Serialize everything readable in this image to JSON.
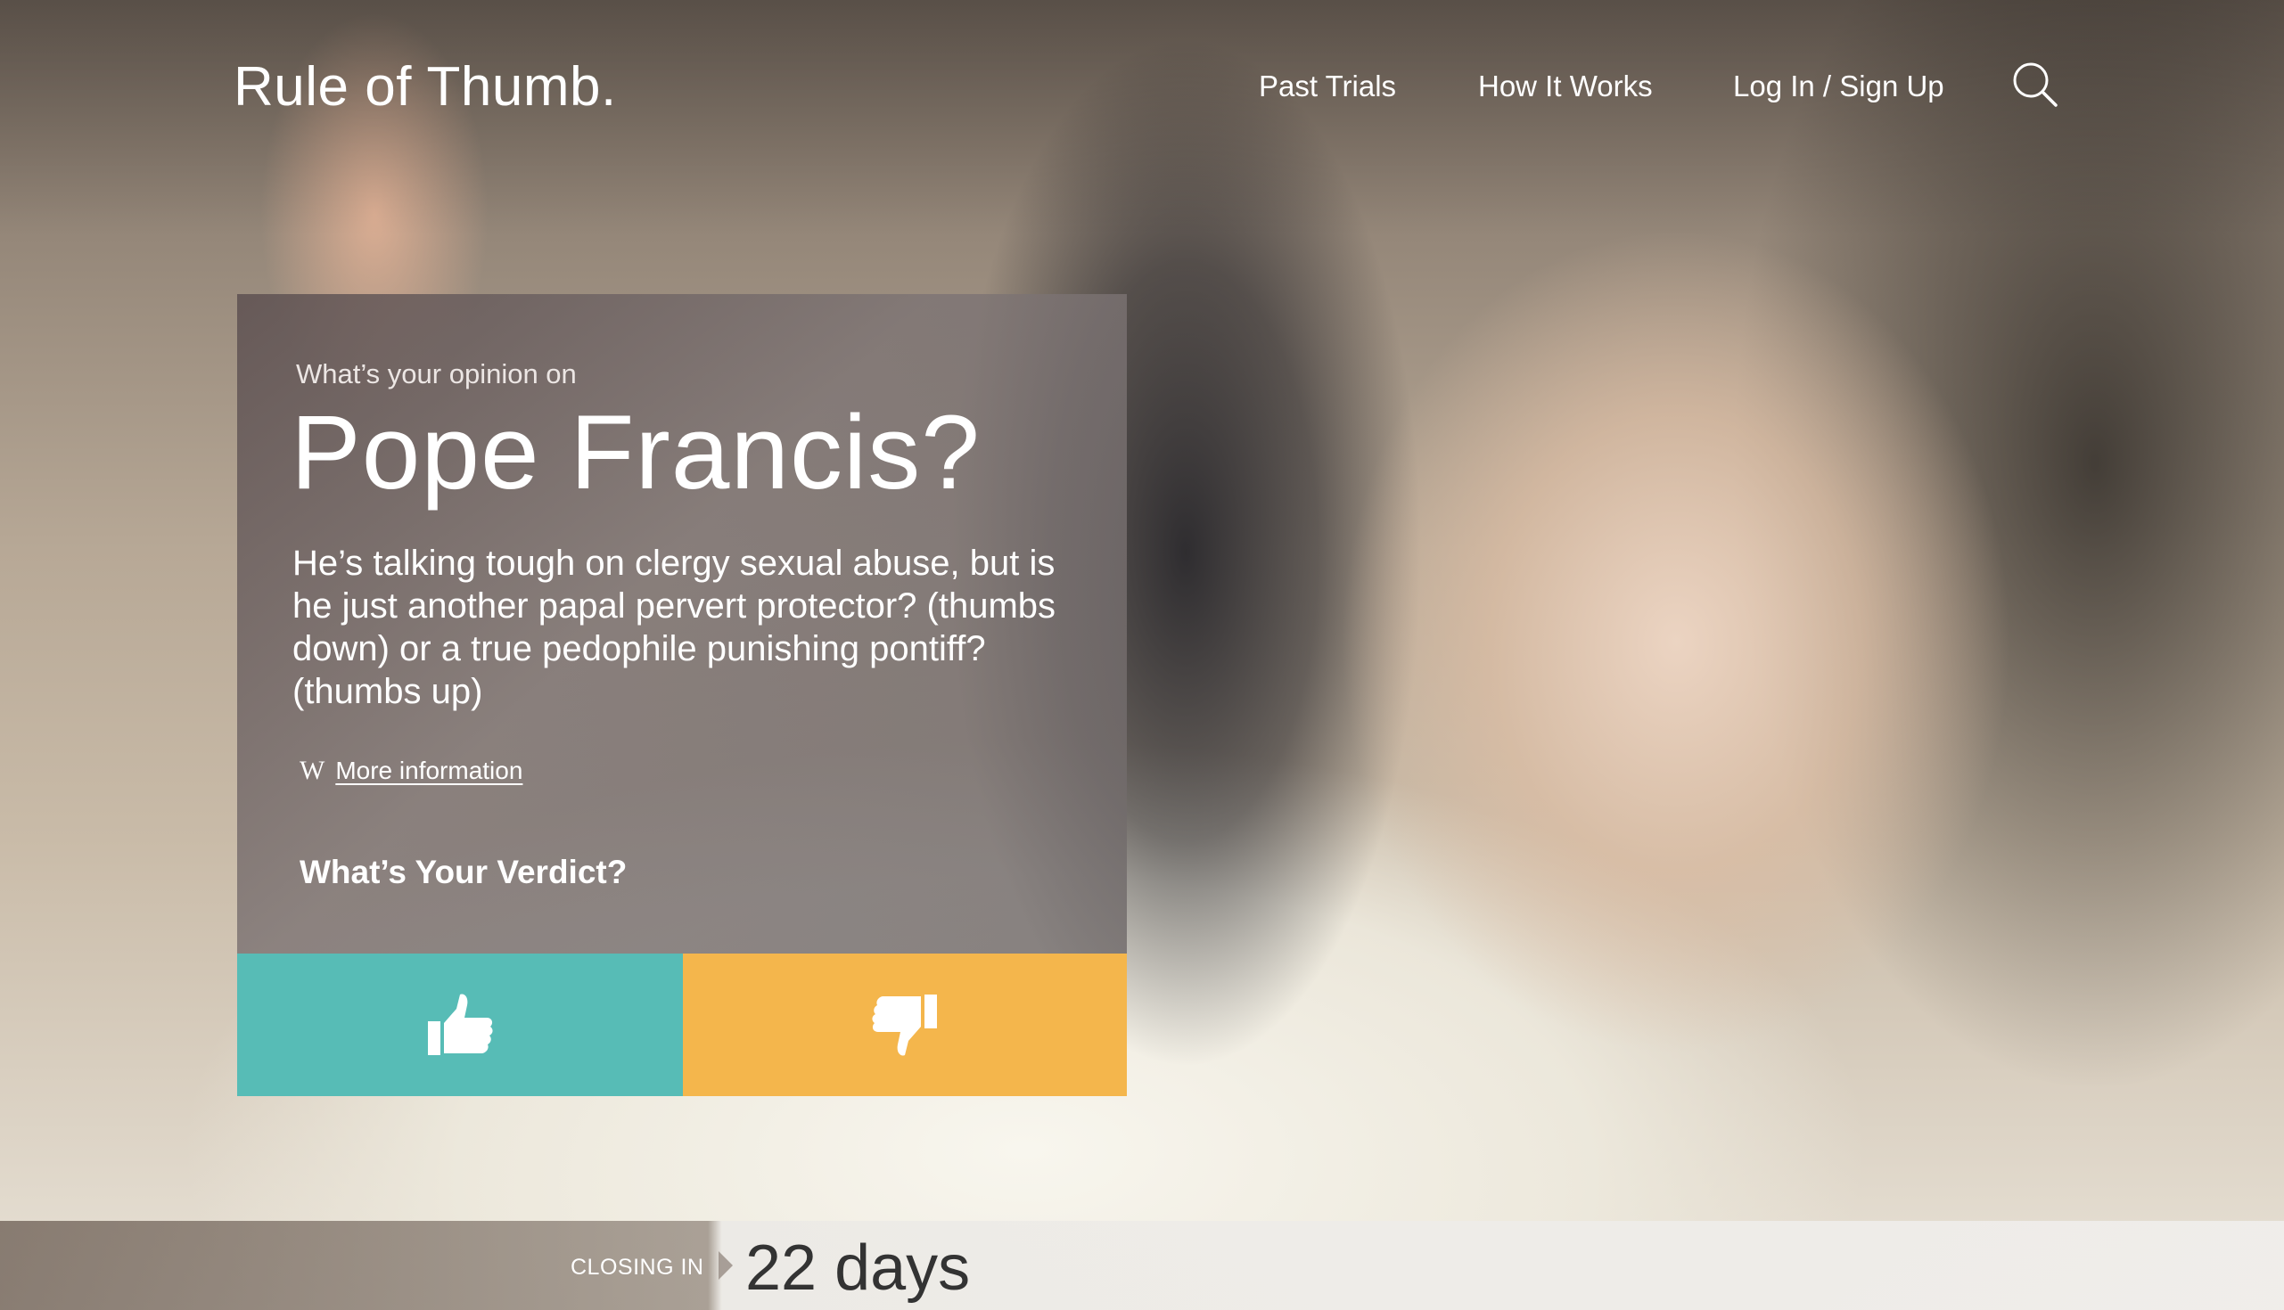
{
  "header": {
    "logo": "Rule of Thumb.",
    "nav": [
      "Past Trials",
      "How It Works",
      "Log In / Sign Up"
    ],
    "search_icon": "search-icon"
  },
  "trial": {
    "kicker": "What’s your opinion on",
    "subject": "Pope Francis?",
    "description": "He’s talking tough on clergy sexual abuse, but is he just another papal pervert protector? (thumbs down) or a true pedophile punishing pontiff? (thumbs up)",
    "more_info_icon": "W",
    "more_info_label": "More information",
    "verdict_title": "What’s Your Verdict?",
    "vote_up_icon": "thumbs-up-icon",
    "vote_down_icon": "thumbs-down-icon"
  },
  "closing": {
    "label": "CLOSING IN",
    "value": "22 days"
  },
  "colors": {
    "vote_up": "#57bcb6",
    "vote_down": "#f4b64c",
    "closing_text": "#333333"
  }
}
